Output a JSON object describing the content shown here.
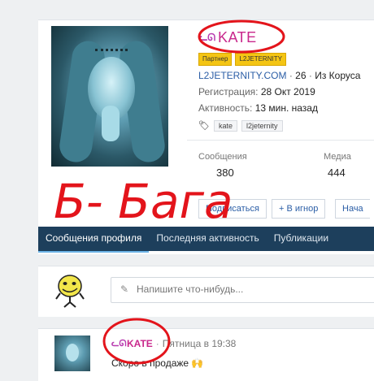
{
  "profile": {
    "username": "KATE",
    "badges": [
      "Партнер",
      "L2JETERNITY"
    ],
    "site_line": {
      "site": "L2JETERNITY.COM",
      "separator1": "·",
      "age": "26",
      "separator2": "·",
      "location": "Из Коруса"
    },
    "registration_label": "Регистрация:",
    "registration_value": "28 Окт 2019",
    "activity_label": "Активность:",
    "activity_value": "13 мин. назад",
    "tags": [
      "kate",
      "l2jeternity"
    ],
    "stats": {
      "messages_label": "Сообщения",
      "messages_value": "380",
      "media_label": "Медиа",
      "media_value": "444"
    },
    "buttons": {
      "follow": "Подписаться",
      "ignore": "+ В игнор",
      "start": "Нача"
    }
  },
  "tabs": [
    "Сообщения профиля",
    "Последняя активность",
    "Публикации"
  ],
  "compose": {
    "placeholder": "Напишите что-нибудь..."
  },
  "post": {
    "author": "KATE",
    "separator": "·",
    "time": "Пятница в 19:38",
    "text": "Скоро в продаже 🙌"
  },
  "annotation": {
    "handwritten_text": "Б- Бага",
    "ink_color": "#e3141b"
  },
  "colors": {
    "username": "#c9288c",
    "tab_bar": "#1d3f5c",
    "link": "#2b5ea6",
    "badge": "#f4c514"
  }
}
